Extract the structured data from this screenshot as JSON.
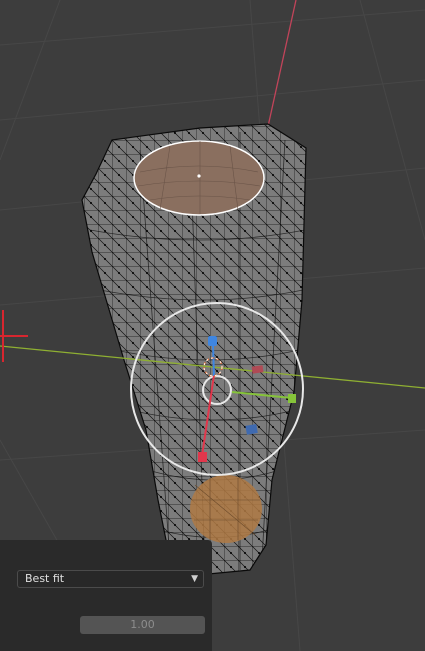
{
  "viewport": {
    "colors": {
      "background": "#3d3d3d",
      "grid": "#474747",
      "x_axis": "#8fb032",
      "y_axis": "#c2445a",
      "mesh_wire": "#0a0a0a",
      "selected_face_fill": "#8a6f5f",
      "gizmo_ring": "#e8e8e8",
      "gizmo_x": "#e2374c",
      "gizmo_y": "#86c43a",
      "gizmo_z": "#3f86e0",
      "bottom_face_fill": "#b07a44"
    },
    "icons": {
      "cursor": "3d-cursor-icon",
      "transform_gizmo": "transform-gizmo-icon"
    }
  },
  "redo_panel": {
    "method_select": {
      "value": "Best fit"
    },
    "factor_field": {
      "value": "1.00"
    }
  }
}
